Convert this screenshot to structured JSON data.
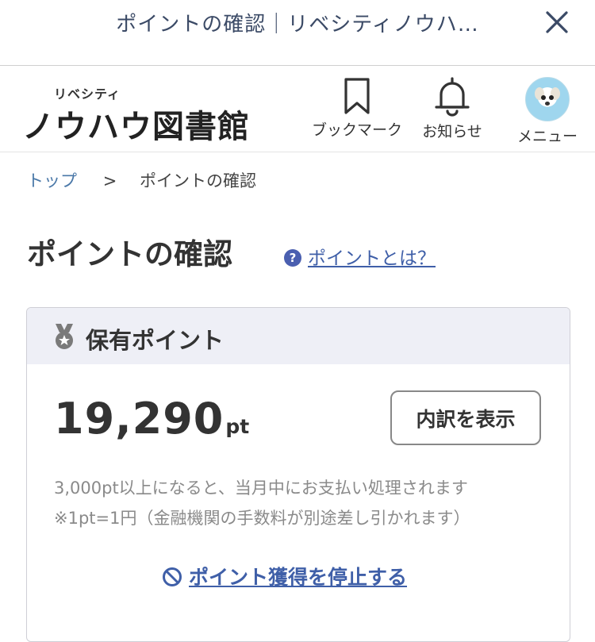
{
  "browser": {
    "title": "ポイントの確認｜リベシティノウハ…"
  },
  "header": {
    "logo_sub": "リベシティ",
    "logo_main": "ノウハウ図書館",
    "nav": {
      "bookmark": "ブックマーク",
      "notifications": "お知らせ",
      "menu": "メニュー"
    }
  },
  "breadcrumb": {
    "top": "トップ",
    "separator": ">",
    "current": "ポイントの確認"
  },
  "page": {
    "title": "ポイントの確認",
    "help_link": "ポイントとは？"
  },
  "points_card": {
    "heading": "保有ポイント",
    "value": "19,290",
    "unit": "pt",
    "detail_button": "内訳を表示",
    "note_1": "3,000pt以上になると、当月中にお支払い処理されます",
    "note_2": "※1pt=1円（金融機関の手数料が別途差し引かれます）",
    "stop_link": "ポイント獲得を停止する"
  },
  "colors": {
    "link": "#3f5fa8",
    "card_header_bg": "#eeeff6",
    "muted_text": "#8a8a8a"
  }
}
